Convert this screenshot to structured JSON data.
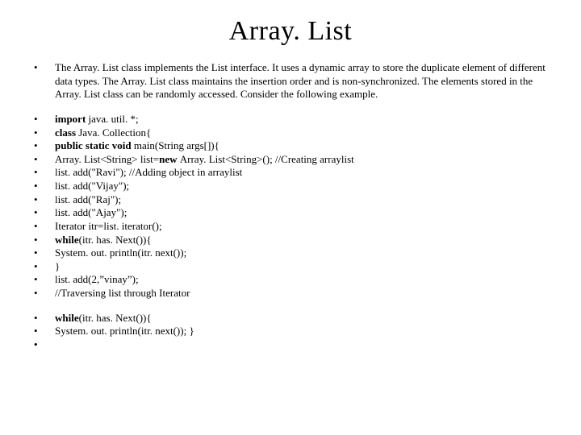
{
  "title": "Array. List",
  "desc": "The Array. List class implements the List interface. It uses a dynamic array to store the duplicate element of different data types. The Array. List class maintains the insertion order and is non-synchronized. The elements stored in the Array. List class can be randomly accessed. Consider the following example.",
  "code1": {
    "l1a": "import ",
    "l1b": "java. util. *;",
    "l2a": "class ",
    "l2b": "Java. Collection{",
    "l3a": "public static void ",
    "l3b": "main(String args[]){",
    "l4a": "Array. List<String> list=",
    "l4b": "new ",
    "l4c": "Array. List<String>(); //Creating arraylist",
    "l5": "list. add(\"Ravi\"); //Adding object in arraylist",
    "l6": "list. add(\"Vijay\");",
    "l7": "list. add(\"Raj\");",
    "l8": "list. add(\"Ajay\");",
    "l9": "Iterator itr=list. iterator();",
    "l10a": "while",
    "l10b": "(itr. has. Next()){",
    "l11": "System. out. println(itr. next());",
    "l12": "}",
    "l13": "list. add(2,”vinay”);",
    "l14": "//Traversing list through Iterator"
  },
  "code2": {
    "l1a": "while",
    "l1b": "(itr. has. Next()){",
    "l2": "System. out. println(itr. next()); }",
    "l3": "",
    "l4": ""
  }
}
